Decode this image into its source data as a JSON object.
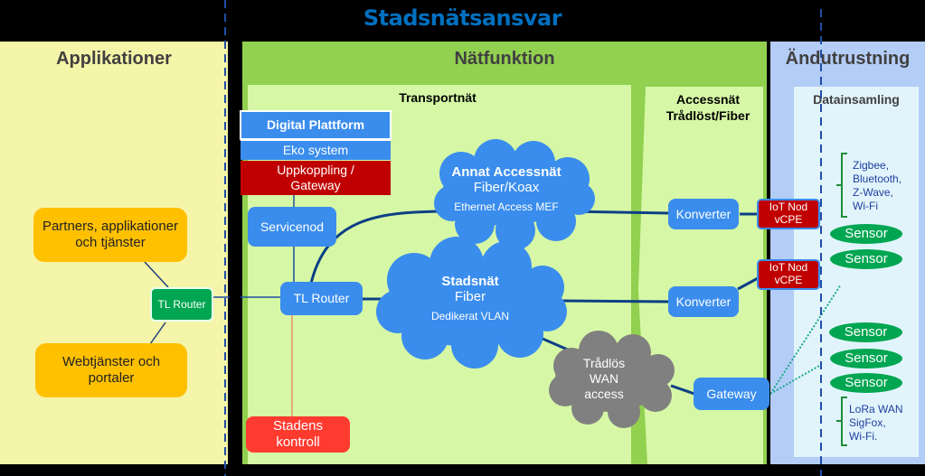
{
  "title": "Stadsnätsansvar",
  "zones": {
    "applications": {
      "label": "Applikationer"
    },
    "network": {
      "label": "Nätfunktion"
    },
    "end_equipment": {
      "label": "Ändutrustning"
    }
  },
  "subzones": {
    "transport": "Transportnät",
    "access_line1": "Accessnät",
    "access_line2": "Trådlöst/Fiber",
    "data_collection": "Datainsamling"
  },
  "platform_stack": {
    "digital_platform": "Digital Plattform",
    "eco_system": "Eko system",
    "uplink_line1": "Uppkoppling  /",
    "uplink_line2": "Gateway"
  },
  "nodes": {
    "servicenod": "Servicenod",
    "tl_router_main": "TL Router",
    "tl_router_app": "TL Router",
    "partners_line1": "Partners, applikationer",
    "partners_line2": "och tjänster",
    "web_line1": "Webtjänster och",
    "web_line2": "portaler",
    "city_control_line1": "Stadens",
    "city_control_line2": "kontroll",
    "converter_1": "Konverter",
    "converter_2": "Konverter",
    "gateway": "Gateway",
    "iot_1_line1": "IoT Nod",
    "iot_1_line2": "vCPE",
    "iot_2_line1": "IoT Nod",
    "iot_2_line2": "vCPE"
  },
  "clouds": {
    "other_access": {
      "title": "Annat Accessnät",
      "subtitle": "Fiber/Koax",
      "detail": "Ethernet Access MEF"
    },
    "city_network": {
      "title": "Stadsnät",
      "subtitle": "Fiber",
      "detail": "Dedikerat VLAN"
    },
    "wireless_wan": {
      "line1": "Trådlös",
      "line2": "WAN",
      "line3": "access"
    }
  },
  "sensors": [
    "Sensor",
    "Sensor",
    "Sensor",
    "Sensor",
    "Sensor"
  ],
  "protocols": {
    "short_range": [
      "Zigbee,",
      "Bluetooth,",
      "Z-Wave,",
      "Wi-Fi"
    ],
    "long_range": [
      "LoRa WAN",
      "SigFox,",
      "Wi-Fi."
    ]
  },
  "colors": {
    "title": "#0070c0",
    "app_zone": "#f5f5a9",
    "net_zone": "#92d050",
    "end_zone": "#b4cdf7",
    "node_blue": "#3a8ded",
    "node_orange": "#ffc000",
    "node_red": "#c00000",
    "sensor_green": "#00a651",
    "cloud_gray": "#808080"
  }
}
